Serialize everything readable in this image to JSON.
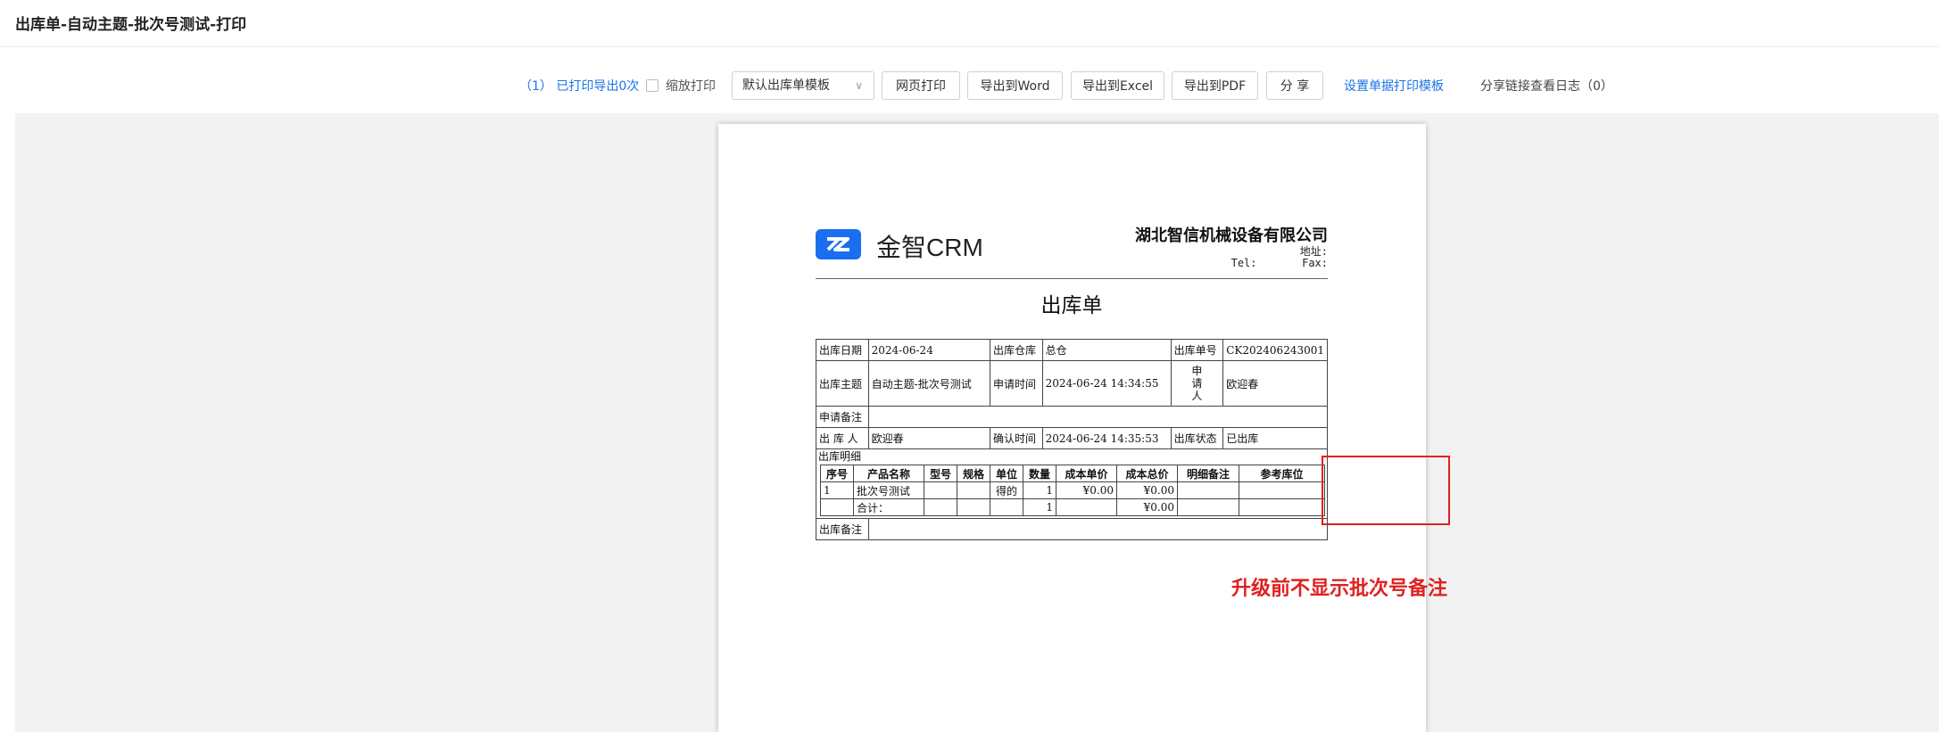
{
  "page": {
    "title": "出库单-自动主题-批次号测试-打印"
  },
  "toolbar": {
    "printed_info": "（1） 已打印导出0次",
    "zoom_print_label": "缩放打印",
    "template_select": "默认出库单模板",
    "web_print": "网页打印",
    "export_word": "导出到Word",
    "export_excel": "导出到Excel",
    "export_pdf": "导出到PDF",
    "share": "分 享",
    "set_template_link": "设置单据打印模板",
    "share_log": "分享链接查看日志（0）"
  },
  "doc": {
    "logo_text": "金智CRM",
    "company": "湖北智信机械设备有限公司",
    "address_label": "地址:",
    "tel_label": "Tel:",
    "fax_label": "Fax:",
    "title": "出库单",
    "info": {
      "date_label": "出库日期",
      "date": "2024-06-24",
      "warehouse_label": "出库仓库",
      "warehouse": "总仓",
      "number_label": "出库单号",
      "number": "CK202406243001",
      "subject_label": "出库主题",
      "subject": "自动主题-批次号测试",
      "apply_time_label": "申请时间",
      "apply_time": "2024-06-24 14:34:55",
      "applicant_label": "申\n请\n人",
      "applicant": "欧迎春",
      "apply_note_label": "申请备注",
      "outbound_person_label": "出 库 人",
      "outbound_person": "欧迎春",
      "confirm_time_label": "确认时间",
      "confirm_time": "2024-06-24 14:35:53",
      "status_label": "出库状态",
      "status": "已出库",
      "detail_label": "出库明细",
      "remark_label": "出库备注"
    },
    "detail": {
      "headers": [
        "序号",
        "产品名称",
        "型号",
        "规格",
        "单位",
        "数量",
        "成本单价",
        "成本总价",
        "明细备注",
        "参考库位"
      ],
      "rows": [
        [
          "1",
          "批次号测试",
          "",
          "",
          "得的",
          "1",
          "¥0.00",
          "¥0.00",
          "",
          ""
        ]
      ],
      "total": {
        "label": "合计：",
        "qty": "1",
        "total_cost": "¥0.00"
      }
    }
  },
  "annotation": {
    "text": "升级前不显示批次号备注",
    "color": "#e02020"
  }
}
